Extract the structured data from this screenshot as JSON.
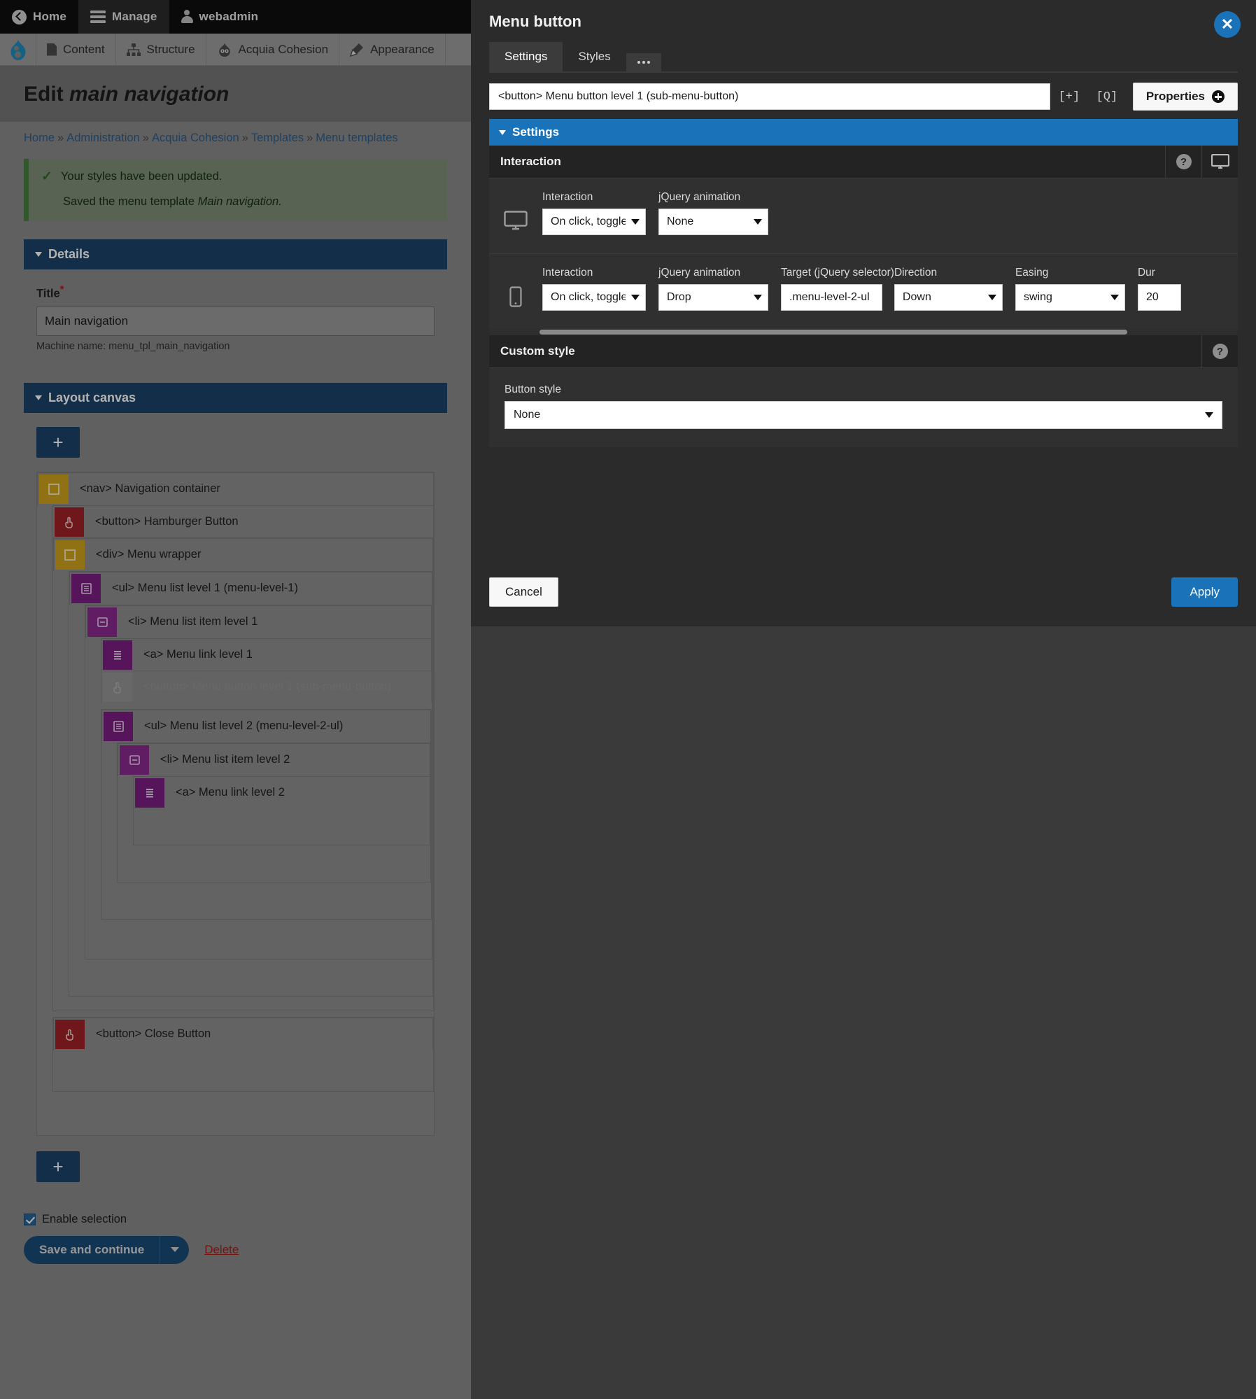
{
  "toolbar": {
    "items": [
      {
        "label": "Home",
        "icon": "home-back-icon",
        "active": false
      },
      {
        "label": "Manage",
        "icon": "hamburger-icon",
        "active": true
      },
      {
        "label": "webadmin",
        "icon": "user-icon",
        "active": false
      }
    ]
  },
  "admin_menu": {
    "logo": "drupal-logo-icon",
    "items": [
      {
        "label": "Content",
        "icon": "document-icon"
      },
      {
        "label": "Structure",
        "icon": "sitemap-icon"
      },
      {
        "label": "Acquia Cohesion",
        "icon": "cohesion-icon"
      },
      {
        "label": "Appearance",
        "icon": "paintbrush-icon"
      }
    ]
  },
  "page": {
    "title_prefix": "Edit",
    "title_em": "main navigation",
    "breadcrumb": [
      "Home",
      "Administration",
      "Acquia Cohesion",
      "Templates",
      "Menu templates"
    ],
    "status": {
      "line1": "Your styles have been updated.",
      "line2_prefix": "Saved the menu template ",
      "line2_em": "Main navigation."
    }
  },
  "details": {
    "legend": "Details",
    "title_label": "Title",
    "title_value": "Main navigation",
    "machine_name": "Machine name: menu_tpl_main_navigation"
  },
  "layout_canvas": {
    "legend": "Layout canvas",
    "add_button": "+",
    "add_button_bottom": "+",
    "tree": [
      {
        "tag": "<nav>",
        "label": "Navigation container",
        "icon": "container-icon",
        "color": "gold",
        "depth": 0,
        "dim": false
      },
      {
        "tag": "<button>",
        "label": "Hamburger Button",
        "icon": "click-hand-icon",
        "color": "red",
        "depth": 1,
        "dim": false
      },
      {
        "tag": "<div>",
        "label": "Menu wrapper",
        "icon": "container-icon",
        "color": "gold",
        "depth": 1,
        "dim": false
      },
      {
        "tag": "<ul>",
        "label": "Menu list level 1 (menu-level-1)",
        "icon": "list-icon",
        "color": "purple-dark",
        "depth": 2,
        "dim": false
      },
      {
        "tag": "<li>",
        "label": "Menu list item level 1",
        "icon": "list-item-icon",
        "color": "purple-mid",
        "depth": 3,
        "dim": false
      },
      {
        "tag": "<a>",
        "label": "Menu link level 1",
        "icon": "link-icon",
        "color": "purple-dark",
        "depth": 4,
        "dim": false
      },
      {
        "tag": "<button>",
        "label": "Menu button level 1 (sub-menu-button)",
        "icon": "click-hand-icon",
        "color": "purple-light",
        "depth": 4,
        "dim": true
      },
      {
        "tag": "<ul>",
        "label": "Menu list level 2 (menu-level-2-ul)",
        "icon": "list-icon",
        "color": "purple-dark",
        "depth": 4,
        "dim": false
      },
      {
        "tag": "<li>",
        "label": "Menu list item level 2",
        "icon": "list-item-icon",
        "color": "purple-mid",
        "depth": 5,
        "dim": false
      },
      {
        "tag": "<a>",
        "label": "Menu link level 2",
        "icon": "link-icon",
        "color": "purple-dark",
        "depth": 6,
        "dim": false
      },
      {
        "tag": "<button>",
        "label": "Close Button",
        "icon": "click-hand-icon",
        "color": "red",
        "depth": 1,
        "dim": false
      }
    ]
  },
  "form_actions": {
    "enable_selection_label": "Enable selection",
    "enable_selection_checked": true,
    "save_label": "Save and continue",
    "delete_label": "Delete"
  },
  "modal": {
    "title": "Menu button",
    "close_icon": "close-x-icon",
    "tabs": [
      {
        "label": "Settings",
        "active": true
      },
      {
        "label": "Styles",
        "active": false
      }
    ],
    "more_tab_icon": "ellipsis-icon",
    "selector_value": "<button> Menu button level 1 (sub-menu-button)",
    "icon_buttons": [
      {
        "label": "[+]",
        "name": "add-bracket-icon"
      },
      {
        "label": "[Q]",
        "name": "search-bracket-icon"
      }
    ],
    "properties_label": "Properties",
    "settings_section": "Settings",
    "interaction": {
      "panel_title": "Interaction",
      "help_icon": "question-mark-icon",
      "device_icon": "monitor-icon",
      "rows": [
        {
          "device": "monitor-icon",
          "fields": [
            {
              "label": "Interaction",
              "value": "On click, toggle :",
              "type": "select",
              "width": "interaction"
            },
            {
              "label": "jQuery animation",
              "value": "None",
              "type": "select",
              "width": "anim"
            }
          ]
        },
        {
          "device": "mobile-icon",
          "fields": [
            {
              "label": "Interaction",
              "value": "On click, toggle :",
              "type": "select",
              "width": "interaction"
            },
            {
              "label": "jQuery animation",
              "value": "Drop",
              "type": "select",
              "width": "anim"
            },
            {
              "label": "Target (jQuery selector)",
              "value": ".menu-level-2-ul",
              "type": "text",
              "width": "target"
            },
            {
              "label": "Direction",
              "value": "Down",
              "type": "select",
              "width": "dir"
            },
            {
              "label": "Easing",
              "value": "swing",
              "type": "select",
              "width": "easing"
            },
            {
              "label": "Dur",
              "value": "20",
              "type": "text",
              "width": "dur"
            }
          ]
        }
      ]
    },
    "custom_style": {
      "panel_title": "Custom style",
      "help_icon": "question-mark-icon",
      "button_style_label": "Button style",
      "button_style_value": "None"
    },
    "cancel_label": "Cancel",
    "apply_label": "Apply"
  },
  "colors": {
    "accent_blue": "#1a73b8",
    "drupal_blue": "#1c4267",
    "danger_red": "#a3201a",
    "gold": "#cfa31c",
    "red_element": "#a02128",
    "purple_dark": "#7b1d82",
    "purple_mid": "#8a2a90"
  }
}
